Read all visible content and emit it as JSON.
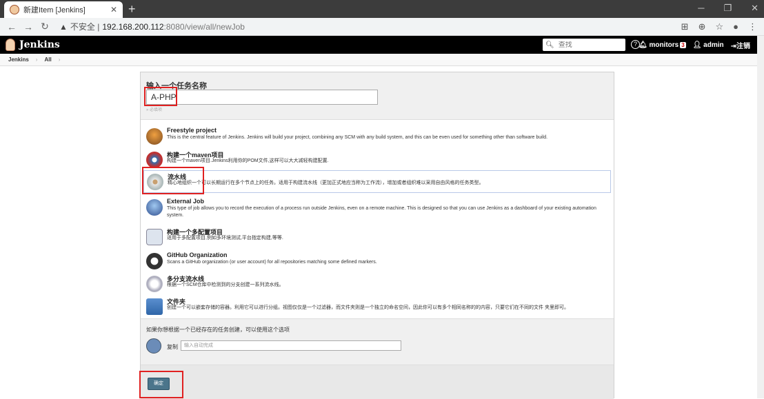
{
  "browser": {
    "tab_title": "新建Item [Jenkins]",
    "new_tab": "+",
    "url_warning": "▲",
    "url_insecure": "不安全 |",
    "url_host": "192.168.200.112",
    "url_path": ":8080/view/all/newJob"
  },
  "header": {
    "app_name": "Jenkins",
    "search_placeholder": "查找",
    "help": "?",
    "monitors_label": "monitors",
    "monitors_count": "3",
    "user": "admin",
    "logout": "注销"
  },
  "breadcrumbs": [
    "Jenkins",
    "All"
  ],
  "form": {
    "name_label": "输入一个任务名称",
    "name_value": "A-PHP",
    "required_note": "» 必填项",
    "items": [
      {
        "title": "Freestyle project",
        "desc": "This is the central feature of Jenkins. Jenkins will build your project, combining any SCM with any build system, and this can be even used for something other than software build."
      },
      {
        "title": "构建一个maven项目",
        "desc": "构建一个maven项目.Jenkins利用你的POM文件,这样可以大大减轻构建配置."
      },
      {
        "title": "流水线",
        "desc": "精心地组织一个可以长期运行在多个节点上的任务。适用于构建流水线（更加正式地应当称为工作流），增加或者组织难以采用自由风格的任务类型。"
      },
      {
        "title": "External Job",
        "desc": "This type of job allows you to record the execution of a process run outside Jenkins, even on a remote machine. This is designed so that you can use Jenkins as a dashboard of your existing automation system."
      },
      {
        "title": "构建一个多配置项目",
        "desc": "适用于多配置项目,例如多环境测试,平台指定构建,等等."
      },
      {
        "title": "GitHub Organization",
        "desc": "Scans a GitHub organization (or user account) for all repositories matching some defined markers."
      },
      {
        "title": "多分支流水线",
        "desc": "根据一个SCM仓库中检测到的分支创建一系列流水线。"
      },
      {
        "title": "文件夹",
        "desc": "创建一个可以嵌套存储的容器。利用它可以进行分组。视图仅仅是一个过滤器，而文件夹则是一个独立的命名空间，因此你可以有多个相同名称的的内容，只要它们在不同的文件 夹里即可。"
      }
    ],
    "copy_hint": "如果你想根据一个已经存在的任务创建，可以使用这个选项",
    "copy_label": "复制",
    "copy_placeholder": "输入自动完成",
    "ok_label": "确定"
  },
  "colors": {
    "header_bg": "#000000",
    "highlight": "#e02020",
    "button": "#4b758b"
  }
}
